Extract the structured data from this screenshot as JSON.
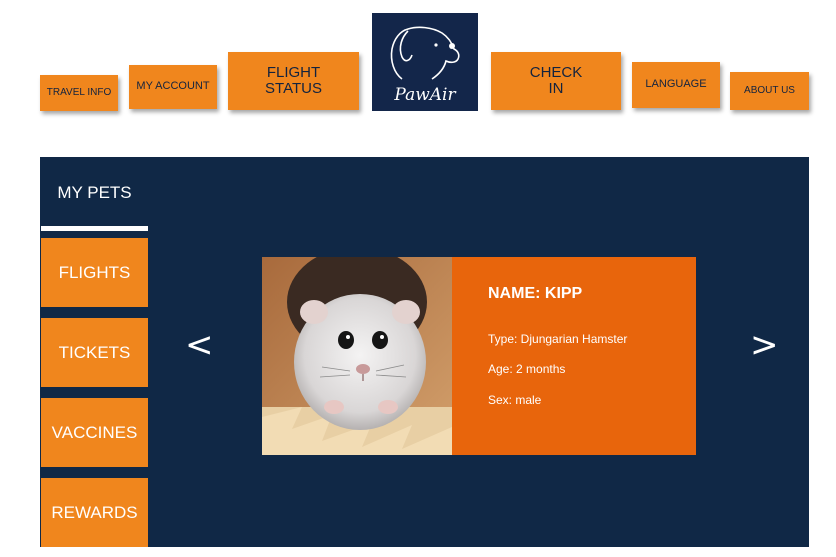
{
  "nav": {
    "travel_info": "TRAVEL INFO",
    "my_account": "MY ACCOUNT",
    "flight_status": "FLIGHT\nSTATUS",
    "check_in": "CHECK\nIN",
    "language": "LANGUAGE",
    "about_us": "ABOUT US"
  },
  "logo": {
    "text": "PawAir",
    "icon": "dog-head-icon"
  },
  "sidebar": {
    "active": "MY PETS",
    "items": [
      {
        "label": "FLIGHTS"
      },
      {
        "label": "TICKETS"
      },
      {
        "label": "VACCINES"
      },
      {
        "label": "REWARDS"
      }
    ]
  },
  "carousel": {
    "prev": "<",
    "next": ">",
    "pet": {
      "name": "NAME:  KIPP",
      "type": "Type: Djungarian Hamster",
      "age": "Age: 2 months",
      "sex": "Sex:  male",
      "photo_icon": "hamster-photo"
    }
  },
  "colors": {
    "orange": "#f0861d",
    "navy": "#102846",
    "card_orange": "#e8650c"
  }
}
